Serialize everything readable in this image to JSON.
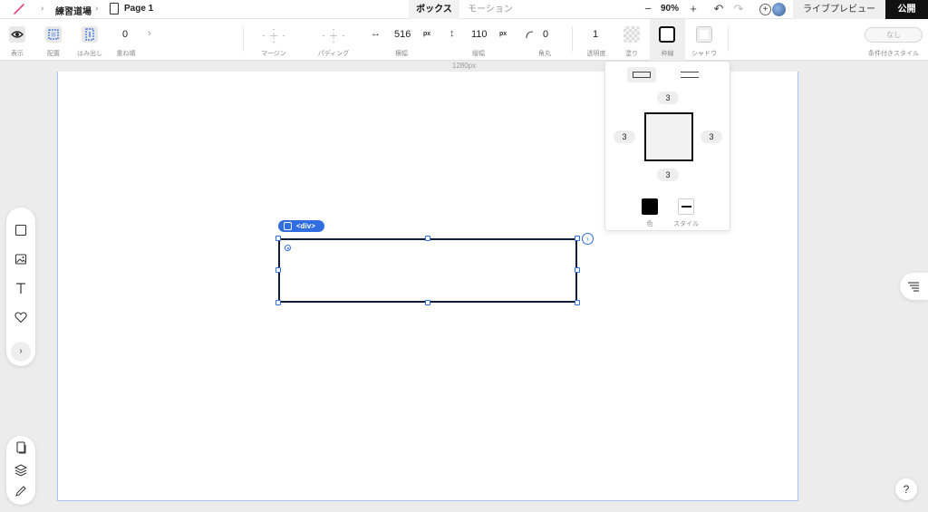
{
  "breadcrumb": {
    "project": "練習道場",
    "page": "Page 1"
  },
  "tabs": {
    "box": "ボックス",
    "motion": "モーション"
  },
  "zoom": {
    "minus": "−",
    "value": "90%",
    "plus": "+"
  },
  "actions": {
    "undo": "↶",
    "redo": "↷",
    "live_preview": "ライブプレビュー",
    "publish": "公開"
  },
  "toolbar": {
    "display_label": "表示",
    "layout_label": "配置",
    "overflow_label": "はみ出し",
    "zindex_value": "0",
    "zindex_label": "重ね順",
    "margin_label": "マージン",
    "padding_label": "パディング",
    "width_value": "516",
    "width_unit": "px",
    "width_label": "横幅",
    "height_value": "110",
    "height_unit": "px",
    "height_label": "縦幅",
    "radius_value": "0",
    "radius_label": "角丸",
    "opacity_value": "1",
    "opacity_label": "透明度",
    "fill_label": "塗り",
    "border_label": "枠線",
    "shadow_label": "シャドウ",
    "condition_value": "なし",
    "condition_label": "条件付きスタイル"
  },
  "ruler": {
    "width_label": "1280px"
  },
  "selection": {
    "tag": "<div>"
  },
  "border_popover": {
    "top": "3",
    "left": "3",
    "right": "3",
    "bottom": "3",
    "color_label": "色",
    "style_label": "スタイル",
    "color": "#000000"
  },
  "help": {
    "label": "?"
  },
  "colors": {
    "accent": "#2f6de0",
    "publish_bg": "#111111"
  }
}
